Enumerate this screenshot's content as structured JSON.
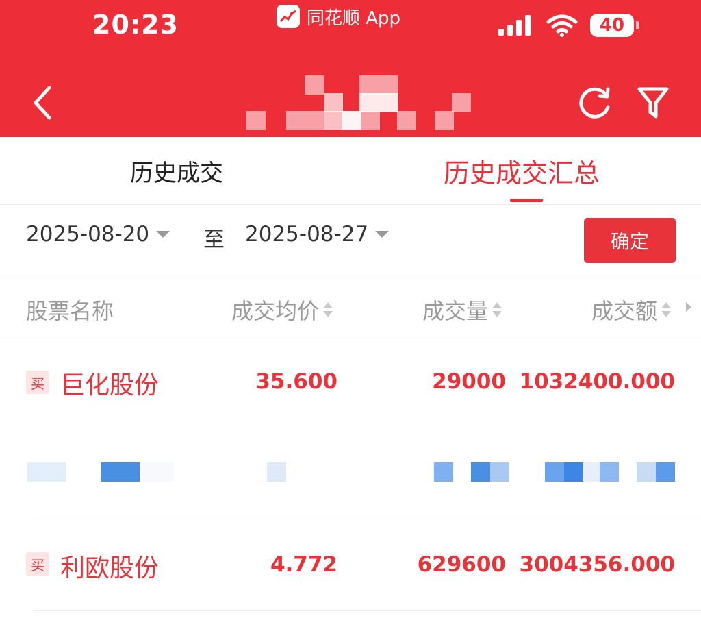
{
  "status_bar": {
    "time": "20:23",
    "source_app": "同花顺 App",
    "battery": "40"
  },
  "colors": {
    "brand": "#ed2e38",
    "price_up": "#e8333b"
  },
  "tabs": [
    {
      "label": "历史成交",
      "active": false
    },
    {
      "label": "历史成交汇总",
      "active": true
    }
  ],
  "date_filter": {
    "start": "2025-08-20",
    "separator": "至",
    "end": "2025-08-27",
    "confirm_label": "确定"
  },
  "table": {
    "columns": [
      "股票名称",
      "成交均价",
      "成交量",
      "成交额"
    ],
    "rows": [
      {
        "side": "买",
        "name": "巨化股份",
        "avg_price": "35.600",
        "volume": "29000",
        "amount": "1032400.000"
      },
      {
        "side": "买",
        "name": "利欧股份",
        "avg_price": "4.772",
        "volume": "629600",
        "amount": "3004356.000"
      }
    ]
  }
}
